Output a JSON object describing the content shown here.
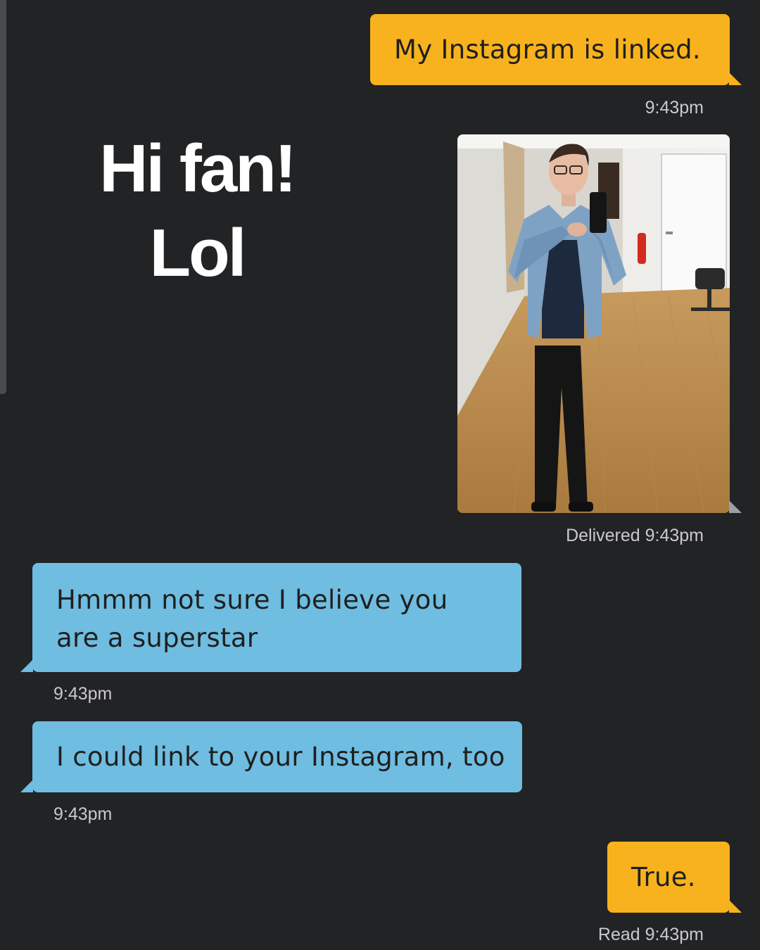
{
  "overlay_caption": {
    "line1": "Hi fan!",
    "line2": "Lol"
  },
  "messages": [
    {
      "side": "sent",
      "text": "My Instagram is linked.",
      "meta": "9:43pm"
    },
    {
      "side": "sent",
      "type": "photo",
      "content": "mirror selfie photo",
      "meta": "Delivered 9:43pm"
    },
    {
      "side": "received",
      "lines": [
        "Hmmm not sure I believe you",
        "are a superstar"
      ],
      "meta": "9:43pm"
    },
    {
      "side": "received",
      "text": "I could link to your Instagram, too",
      "meta": "9:43pm"
    },
    {
      "side": "sent",
      "text": "True.",
      "meta": "Read 9:43pm"
    }
  ],
  "colors": {
    "background": "#222325",
    "sent_bubble": "#f7b21d",
    "received_bubble": "#6fbde0",
    "meta_text": "#c9c9cc",
    "caption_text": "#ffffff"
  }
}
